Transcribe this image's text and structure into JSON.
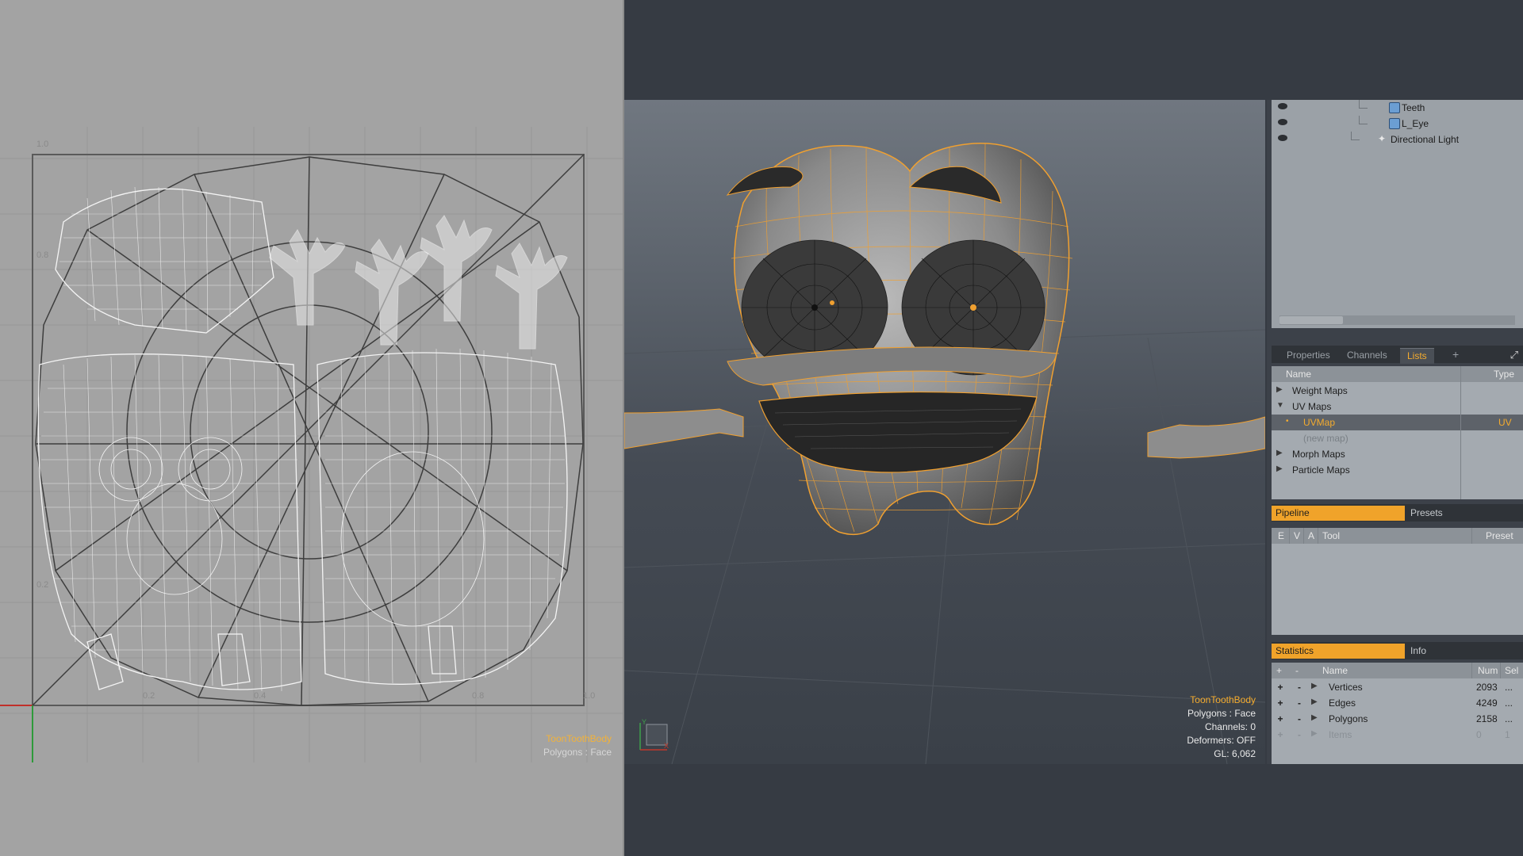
{
  "uv_view": {
    "ticks": {
      "v_top": "1.0",
      "v_08": "0.8",
      "v_02": "0.2",
      "u_02": "0.2",
      "u_04": "0.4",
      "u_08": "0.8",
      "u_10": "1.0"
    },
    "object_name": "ToonToothBody",
    "selection_mode": "Polygons : Face"
  },
  "viewport_3d": {
    "object_name": "ToonToothBody",
    "selection_mode": "Polygons : Face",
    "channels": "Channels: 0",
    "deformers": "Deformers: OFF",
    "gl": "GL: 6,062",
    "axis_y": "Y",
    "axis_x": "X",
    "wire_color": "#f0a030"
  },
  "items_list": {
    "rows": [
      {
        "label": "Teeth",
        "icon": "mesh-icon"
      },
      {
        "label": "L_Eye",
        "icon": "mesh-icon"
      },
      {
        "label": "Directional Light",
        "icon": "light-icon"
      }
    ]
  },
  "properties_tabs": {
    "tabs": [
      "Properties",
      "Channels",
      "Lists"
    ],
    "active": "Lists",
    "add": "+"
  },
  "lists_panel": {
    "col_name": "Name",
    "col_type": "Type",
    "rows": [
      {
        "label": "Weight Maps",
        "expander": "▶",
        "type": ""
      },
      {
        "label": "UV Maps",
        "expander": "▼",
        "type": ""
      },
      {
        "label": "UVMap",
        "expander": "•",
        "type": "UV"
      },
      {
        "label": "(new map)",
        "expander": "",
        "type": ""
      },
      {
        "label": "Morph Maps",
        "expander": "▶",
        "type": ""
      },
      {
        "label": "Particle Maps",
        "expander": "▶",
        "type": ""
      }
    ]
  },
  "pipeline_panel": {
    "tabs": [
      "Pipeline",
      "Presets"
    ],
    "columns": {
      "e": "E",
      "v": "V",
      "a": "A",
      "tool": "Tool",
      "preset": "Preset"
    }
  },
  "stats_panel": {
    "tabs": [
      "Statistics",
      "Info"
    ],
    "columns": {
      "plus": "+",
      "minus": "-",
      "name": "Name",
      "num": "Num",
      "sel": "Sel"
    },
    "rows": [
      {
        "name": "Vertices",
        "num": "2093",
        "sel": "...",
        "plus": "+",
        "minus": "-"
      },
      {
        "name": "Edges",
        "num": "4249",
        "sel": "...",
        "plus": "+",
        "minus": "-"
      },
      {
        "name": "Polygons",
        "num": "2158",
        "sel": "...",
        "plus": "+",
        "minus": "-"
      },
      {
        "name": "Items",
        "num": "0",
        "sel": "1",
        "plus": "+",
        "minus": "-"
      }
    ]
  }
}
